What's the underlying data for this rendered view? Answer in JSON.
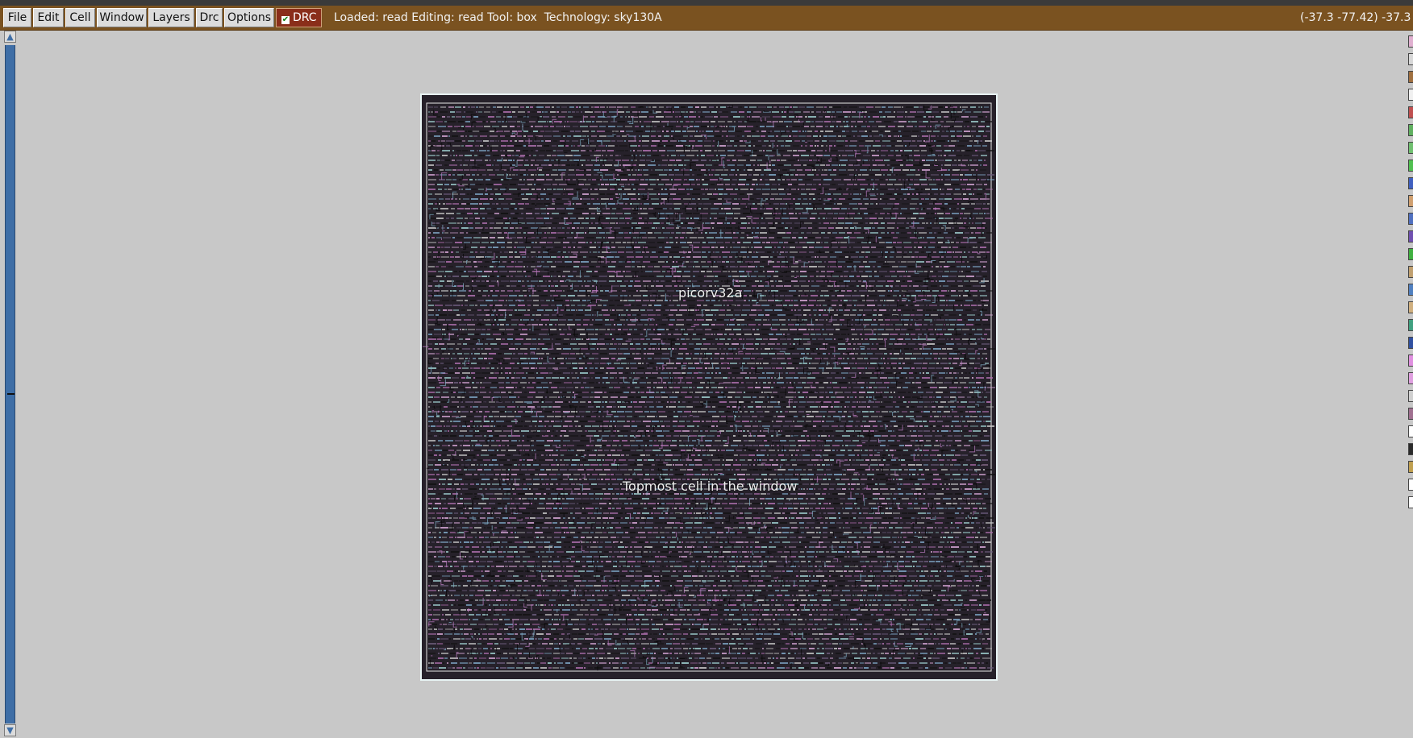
{
  "menu": {
    "items": [
      {
        "id": "file",
        "label": "File"
      },
      {
        "id": "edit",
        "label": "Edit"
      },
      {
        "id": "cell",
        "label": "Cell"
      },
      {
        "id": "window",
        "label": "Window"
      },
      {
        "id": "layers",
        "label": "Layers"
      },
      {
        "id": "drc",
        "label": "Drc"
      },
      {
        "id": "options",
        "label": "Options"
      }
    ],
    "drc_toggle": {
      "label": "DRC",
      "checked": true
    }
  },
  "status": {
    "text": "Loaded: read Editing: read Tool: box  Technology: sky130A",
    "coordinates": "(-37.3 -77.42) -37.3"
  },
  "layout": {
    "cell_name": "picorv32a",
    "cell_subtitle": "Topmost cell in the window"
  },
  "colors": {
    "menubar": "#7a5220",
    "drc_button": "#8a2e1a",
    "scrollbar": "#3f6ea6",
    "canvas_background": "#c8c8c8",
    "cell_fill": "#1d1820"
  },
  "layer_palette": {
    "swatches": [
      "#e0b0d0",
      "#d8d8d8",
      "#a07040",
      "#f0f0f0",
      "#c05050",
      "#60b060",
      "#70c070",
      "#50c050",
      "#4060c0",
      "#d0a070",
      "#5070c0",
      "#7050b0",
      "#40b040",
      "#c0a070",
      "#5080c0",
      "#d0b080",
      "#40a080",
      "#3050a0",
      "#e090e0",
      "#e0a0e0",
      "#d0d0d0",
      "#a07090",
      "#ffffff",
      "#2a2a2a",
      "#c0a050",
      "#ffffff",
      "#ffffff"
    ]
  }
}
